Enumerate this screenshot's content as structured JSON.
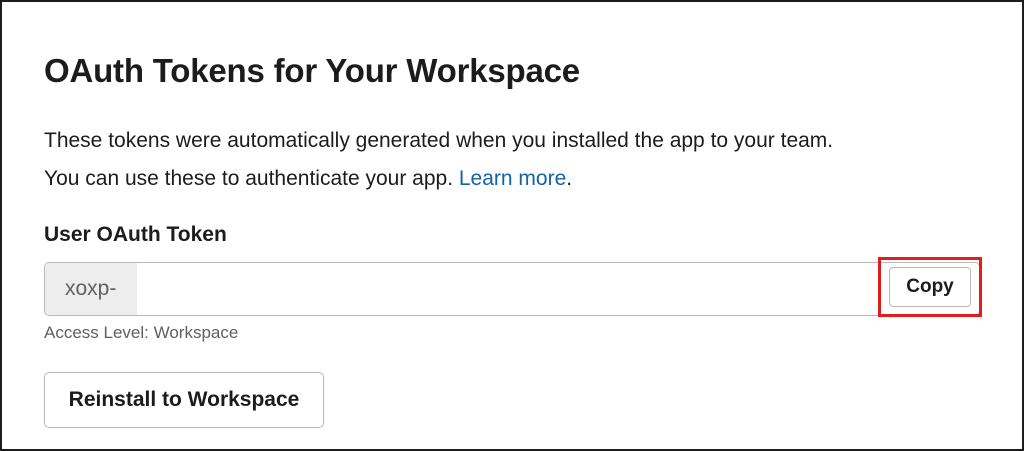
{
  "section": {
    "title": "OAuth Tokens for Your Workspace",
    "description_line1": "These tokens were automatically generated when you installed the app to your team.",
    "description_line2": "You can use these to authenticate your app. ",
    "learn_more_link": "Learn more",
    "description_end": "."
  },
  "token": {
    "label": "User OAuth Token",
    "value": "xoxp-",
    "copy_label": "Copy",
    "access_level": "Access Level: Workspace"
  },
  "actions": {
    "reinstall_label": "Reinstall to Workspace"
  },
  "colors": {
    "link": "#1264a3",
    "highlight": "#e01e1e",
    "text": "#1d1c1d",
    "muted": "#616061"
  }
}
